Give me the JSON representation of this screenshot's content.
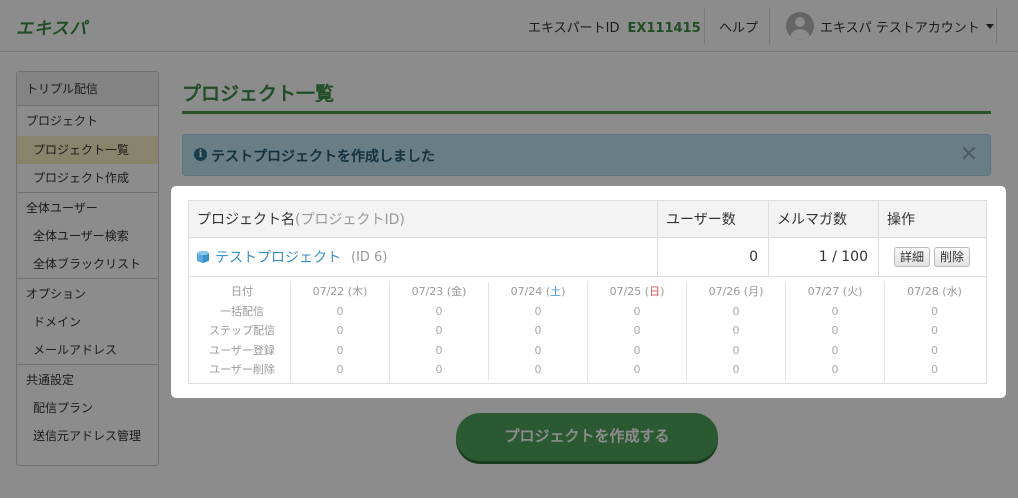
{
  "header": {
    "logo": "エキスパ",
    "id_label": "エキスパートID",
    "id_value": "EX111415",
    "help": "ヘルプ",
    "user_name": "エキスパ テストアカウント"
  },
  "sidebar": {
    "heading": "トリプル配信",
    "sections": [
      {
        "title": "プロジェクト",
        "items": [
          "プロジェクト一覧",
          "プロジェクト作成"
        ]
      },
      {
        "title": "全体ユーザー",
        "items": [
          "全体ユーザー検索",
          "全体ブラックリスト"
        ]
      },
      {
        "title": "オプション",
        "items": [
          "ドメイン",
          "メールアドレス"
        ]
      },
      {
        "title": "共通設定",
        "items": [
          "配信プラン",
          "送信元アドレス管理"
        ]
      }
    ],
    "active_item": "プロジェクト一覧"
  },
  "main": {
    "title": "プロジェクト一覧",
    "alert": "テストプロジェクトを作成しました",
    "alert_close": "×",
    "create_button": "プロジェクトを作成する"
  },
  "table": {
    "headers": {
      "name": "プロジェクト名",
      "name_sub": "(プロジェクトID)",
      "users": "ユーザー数",
      "magazines": "メルマガ数",
      "ops": "操作"
    },
    "row": {
      "name": "テストプロジェクト",
      "id": "(ID 6)",
      "users": "0",
      "magazines": "1 / 100",
      "detail_button": "詳細",
      "delete_button": "削除"
    },
    "stats": {
      "labels": [
        "日付",
        "一括配信",
        "ステップ配信",
        "ユーザー登録",
        "ユーザー削除"
      ],
      "days": [
        {
          "date": "07/22",
          "dow": "木",
          "kind": "normal",
          "values": [
            "0",
            "0",
            "0",
            "0"
          ]
        },
        {
          "date": "07/23",
          "dow": "金",
          "kind": "normal",
          "values": [
            "0",
            "0",
            "0",
            "0"
          ]
        },
        {
          "date": "07/24",
          "dow": "土",
          "kind": "sat",
          "values": [
            "0",
            "0",
            "0",
            "0"
          ]
        },
        {
          "date": "07/25",
          "dow": "日",
          "kind": "sun",
          "values": [
            "0",
            "0",
            "0",
            "0"
          ]
        },
        {
          "date": "07/26",
          "dow": "月",
          "kind": "normal",
          "values": [
            "0",
            "0",
            "0",
            "0"
          ]
        },
        {
          "date": "07/27",
          "dow": "火",
          "kind": "normal",
          "values": [
            "0",
            "0",
            "0",
            "0"
          ]
        },
        {
          "date": "07/28",
          "dow": "水",
          "kind": "normal",
          "values": [
            "0",
            "0",
            "0",
            "0"
          ]
        }
      ]
    }
  },
  "colors": {
    "brand_green": "#3d8b45",
    "link_blue": "#3a8fc4",
    "sunday_red": "#d9534f",
    "alert_bg": "#bfe3f0"
  }
}
